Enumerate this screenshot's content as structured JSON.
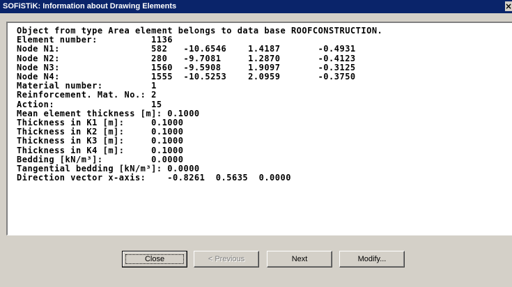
{
  "window": {
    "title": "SOFiSTiK: Information about Drawing Elements",
    "close_glyph": "×"
  },
  "content": {
    "lines": [
      "Object from type Area element belongs to data base ROOFCONSTRUCTION.",
      "Element number:          1136",
      "Node N1:                 582   -10.6546    1.4187       -0.4931",
      "Node N2:                 280   -9.7081     1.2870       -0.4123",
      "Node N3:                 1560  -9.5908     1.9097       -0.3125",
      "Node N4:                 1555  -10.5253    2.0959       -0.3750",
      "Material number:         1",
      "Reinforcement. Mat. No.: 2",
      "Action:                  15",
      "Mean element thickness [m]: 0.1000",
      "Thickness in K1 [m]:     0.1000",
      "Thickness in K2 [m]:     0.1000",
      "Thickness in K3 [m]:     0.1000",
      "Thickness in K4 [m]:     0.1000",
      "Bedding [kN/m³]:         0.0000",
      "Tangential bedding [kN/m³]: 0.0000",
      "Direction vector x-axis:    -0.8261  0.5635  0.0000"
    ]
  },
  "buttons": {
    "close": "Close",
    "previous": "< Previous",
    "next": "Next",
    "modify": "Modify..."
  }
}
